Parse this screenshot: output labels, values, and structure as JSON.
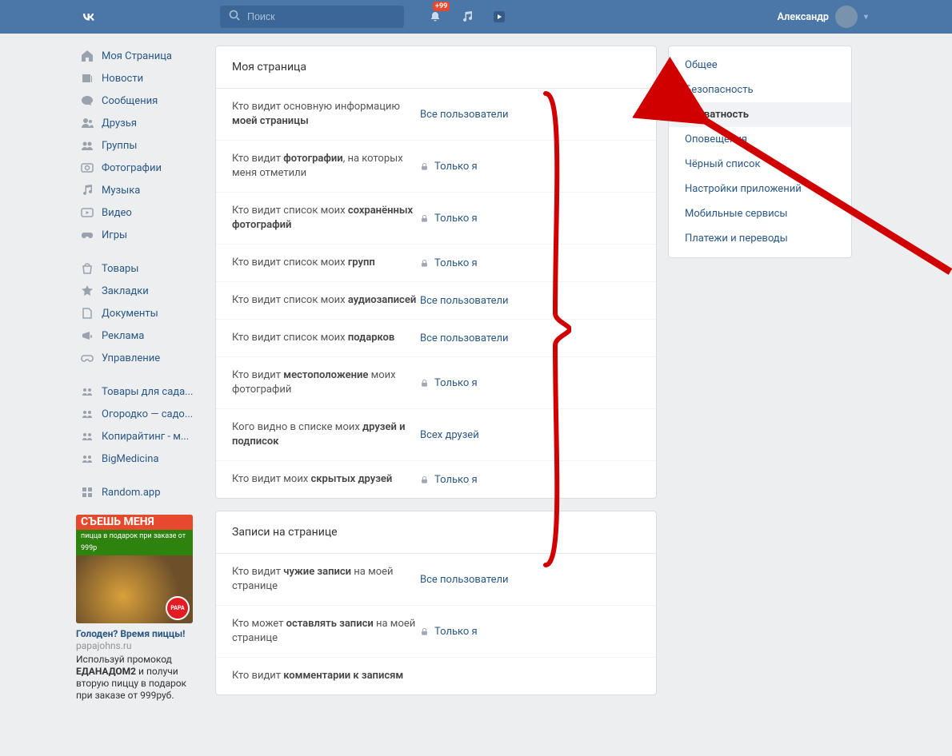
{
  "header": {
    "search_placeholder": "Поиск",
    "badge": "+99",
    "username": "Александр"
  },
  "left_nav_main": [
    {
      "icon": "home",
      "label": "Моя Страница"
    },
    {
      "icon": "news",
      "label": "Новости"
    },
    {
      "icon": "msg",
      "label": "Сообщения"
    },
    {
      "icon": "friends",
      "label": "Друзья"
    },
    {
      "icon": "group",
      "label": "Группы"
    },
    {
      "icon": "photo",
      "label": "Фотографии"
    },
    {
      "icon": "music",
      "label": "Музыка"
    },
    {
      "icon": "video",
      "label": "Видео"
    },
    {
      "icon": "games",
      "label": "Игры"
    }
  ],
  "left_nav_secondary": [
    {
      "icon": "market",
      "label": "Товары"
    },
    {
      "icon": "bookmark",
      "label": "Закладки"
    },
    {
      "icon": "docs",
      "label": "Документы"
    },
    {
      "icon": "ads",
      "label": "Реклама"
    },
    {
      "icon": "manage",
      "label": "Управление"
    }
  ],
  "left_nav_groups": [
    {
      "icon": "community",
      "label": "Товары для сада..."
    },
    {
      "icon": "community",
      "label": "Огородко — садо..."
    },
    {
      "icon": "community",
      "label": "Копирайтинг - м..."
    },
    {
      "icon": "community",
      "label": "BigMedicina"
    }
  ],
  "left_nav_apps": [
    {
      "icon": "app",
      "label": "Random.app"
    }
  ],
  "ad": {
    "strip": "СЪЕШЬ МЕНЯ",
    "sub": "пицца в подарок при заказе от 999р",
    "title": "Голоден? Время пиццы!",
    "domain": "papajohns.ru",
    "text_before": "Используй промокод ",
    "text_bold": "ЕДАНАДОМ2",
    "text_after": " и получи вторую пиццу в подарок при заказе от 999руб."
  },
  "sections": [
    {
      "title": "Моя страница",
      "rows": [
        {
          "q_pre": "Кто видит основную информацию ",
          "q_b": "моей страницы",
          "q_post": "",
          "value": "Все пользователи",
          "lock": false
        },
        {
          "q_pre": "Кто видит ",
          "q_b": "фотографии",
          "q_post": ", на которых меня отметили",
          "value": "Только я",
          "lock": true
        },
        {
          "q_pre": "Кто видит список моих ",
          "q_b": "сохранённых фотографий",
          "q_post": "",
          "value": "Только я",
          "lock": true
        },
        {
          "q_pre": "Кто видит список моих ",
          "q_b": "групп",
          "q_post": "",
          "value": "Только я",
          "lock": true
        },
        {
          "q_pre": "Кто видит список моих ",
          "q_b": "аудиозаписей",
          "q_post": "",
          "value": "Все пользователи",
          "lock": false
        },
        {
          "q_pre": "Кто видит список моих ",
          "q_b": "подарков",
          "q_post": "",
          "value": "Все пользователи",
          "lock": false
        },
        {
          "q_pre": "Кто видит ",
          "q_b": "местоположение",
          "q_post": " моих фотографий",
          "value": "Только я",
          "lock": true
        },
        {
          "q_pre": "Кого видно в списке моих ",
          "q_b": "друзей и подписок",
          "q_post": "",
          "value": "Всех друзей",
          "lock": false
        },
        {
          "q_pre": "Кто видит моих ",
          "q_b": "скрытых друзей",
          "q_post": "",
          "value": "Только я",
          "lock": true
        }
      ]
    },
    {
      "title": "Записи на странице",
      "rows": [
        {
          "q_pre": "Кто видит ",
          "q_b": "чужие записи",
          "q_post": " на моей странице",
          "value": "Все пользователи",
          "lock": false
        },
        {
          "q_pre": "Кто может ",
          "q_b": "оставлять записи",
          "q_post": " на моей странице",
          "value": "Только я",
          "lock": true
        },
        {
          "q_pre": "Кто видит ",
          "q_b": "комментарии к записям",
          "q_post": "",
          "value": "",
          "lock": false
        }
      ]
    }
  ],
  "right_menu": [
    {
      "label": "Общее",
      "active": false
    },
    {
      "label": "Безопасность",
      "active": false
    },
    {
      "label": "Приватность",
      "active": true
    },
    {
      "label": "Оповещения",
      "active": false
    },
    {
      "label": "Чёрный список",
      "active": false
    },
    {
      "label": "Настройки приложений",
      "active": false
    },
    {
      "label": "Мобильные сервисы",
      "active": false
    },
    {
      "label": "Платежи и переводы",
      "active": false
    }
  ]
}
